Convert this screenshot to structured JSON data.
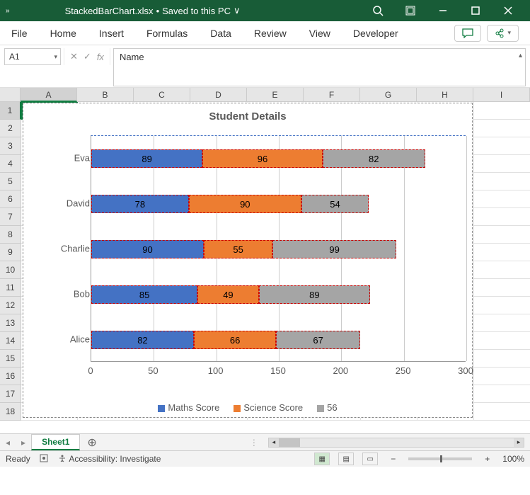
{
  "titlebar": {
    "chevron": "»",
    "filename": "StackedBarChart.xlsx",
    "save_status": "Saved to this PC",
    "dropdown": "∨"
  },
  "ribbon": {
    "tabs": [
      "File",
      "Home",
      "Insert",
      "Formulas",
      "Data",
      "Review",
      "View",
      "Developer"
    ]
  },
  "formula_bar": {
    "cell_ref": "A1",
    "value": "Name"
  },
  "columns": [
    "A",
    "B",
    "C",
    "D",
    "E",
    "F",
    "G",
    "H",
    "I"
  ],
  "rows": [
    "1",
    "2",
    "3",
    "4",
    "5",
    "6",
    "7",
    "8",
    "9",
    "10",
    "11",
    "12",
    "13",
    "14",
    "15",
    "16",
    "17",
    "18"
  ],
  "sheet_tab": "Sheet1",
  "status": {
    "ready": "Ready",
    "accessibility": "Accessibility: Investigate",
    "zoom": "100%"
  },
  "chart_data": {
    "type": "bar",
    "title": "Student Details",
    "categories": [
      "Eva",
      "David",
      "Charlie",
      "Bob",
      "Alice"
    ],
    "series": [
      {
        "name": "Maths Score",
        "color": "#4472c4",
        "values": [
          89,
          78,
          90,
          85,
          82
        ]
      },
      {
        "name": "Science Score",
        "color": "#ed7d31",
        "values": [
          96,
          90,
          55,
          49,
          66
        ]
      },
      {
        "name": "56",
        "color": "#a5a5a5",
        "values": [
          82,
          54,
          99,
          89,
          67
        ]
      }
    ],
    "x_ticks": [
      0,
      50,
      100,
      150,
      200,
      250,
      300
    ],
    "xlim": [
      0,
      300
    ]
  }
}
